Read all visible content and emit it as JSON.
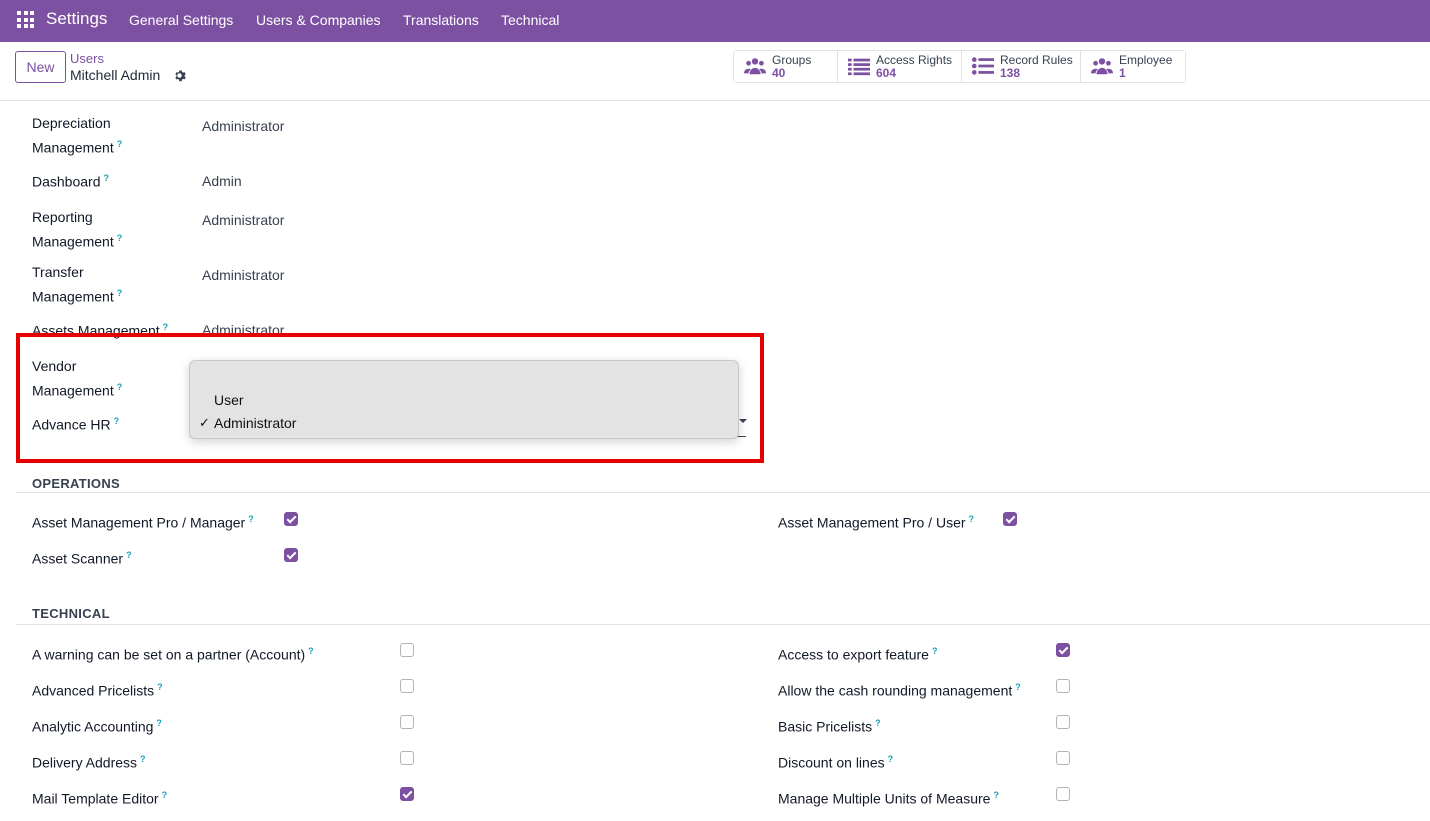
{
  "navbar": {
    "brand": "Settings",
    "items": [
      "General Settings",
      "Users & Companies",
      "Translations",
      "Technical"
    ]
  },
  "control_panel": {
    "new_label": "New",
    "breadcrumb_parent": "Users",
    "breadcrumb_current": "Mitchell Admin",
    "smart_buttons": [
      {
        "label": "Groups",
        "value": "40",
        "icon": "users-icon"
      },
      {
        "label": "Access Rights",
        "value": "604",
        "icon": "list-icon"
      },
      {
        "label": "Record Rules",
        "value": "138",
        "icon": "list-bullets-icon"
      },
      {
        "label": "Employee",
        "value": "1",
        "icon": "users-icon"
      }
    ]
  },
  "app_fields": [
    {
      "label_l1": "Depreciation",
      "label_l2": "Management",
      "value": "Administrator"
    },
    {
      "label_l1": "Dashboard",
      "label_l2": "",
      "value": "Admin"
    },
    {
      "label_l1": "Reporting",
      "label_l2": "Management",
      "value": "Administrator"
    },
    {
      "label_l1": "Transfer",
      "label_l2": "Management",
      "value": "Administrator"
    },
    {
      "label_l1": "Assets Management",
      "label_l2": "",
      "value": "Administrator"
    },
    {
      "label_l1": "Vendor",
      "label_l2": "Management",
      "value": ""
    },
    {
      "label_l1": "Advance HR",
      "label_l2": "",
      "value": "Administrator"
    }
  ],
  "help_mark": "?",
  "dropdown": {
    "options": [
      "User",
      "Administrator"
    ],
    "selected": "Administrator",
    "check": "✓"
  },
  "operations": {
    "title": "OPERATIONS",
    "items": [
      {
        "label": "Asset Management Pro / Manager",
        "checked": true
      },
      {
        "label": "Asset Management Pro / User",
        "checked": true
      },
      {
        "label": "Asset Scanner",
        "checked": true
      }
    ]
  },
  "technical": {
    "title": "TECHNICAL",
    "left": [
      {
        "label": "A warning can be set on a partner (Account)",
        "checked": false
      },
      {
        "label": "Advanced Pricelists",
        "checked": false
      },
      {
        "label": "Analytic Accounting",
        "checked": false
      },
      {
        "label": "Delivery Address",
        "checked": false
      },
      {
        "label": "Mail Template Editor",
        "checked": true
      }
    ],
    "right": [
      {
        "label": "Access to export feature",
        "checked": true
      },
      {
        "label": "Allow the cash rounding management",
        "checked": false
      },
      {
        "label": "Basic Pricelists",
        "checked": false
      },
      {
        "label": "Discount on lines",
        "checked": false
      },
      {
        "label": "Manage Multiple Units of Measure",
        "checked": false
      }
    ]
  },
  "colors": {
    "brand": "#7c51a1",
    "highlight": "#e60000",
    "help": "#17a2b8"
  }
}
